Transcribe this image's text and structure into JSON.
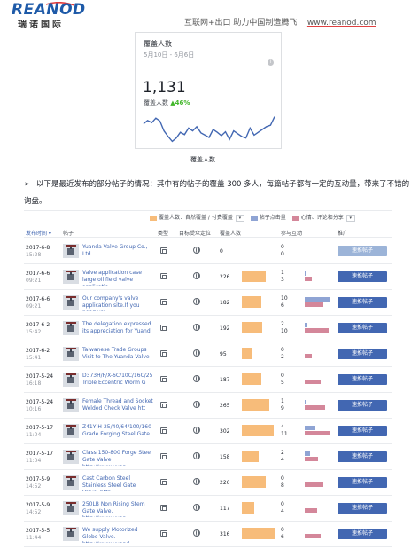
{
  "header": {
    "logo_text": "REANOD",
    "logo_cn": "瑞诺国际",
    "slogan": "互联网+出口  助力中国制造腾飞",
    "url": "www.reanod.com"
  },
  "reach_card": {
    "title": "覆盖人数",
    "date_range": "5月10日 - 6月6日",
    "info_icon": "i",
    "value": "1,131",
    "sub_label": "覆盖人数",
    "change": "▲46%",
    "caption": "覆盖人数",
    "sparkline": [
      0.3,
      0.18,
      0.26,
      0.1,
      0.2,
      0.55,
      0.75,
      0.92,
      0.8,
      0.6,
      0.68,
      0.45,
      0.55,
      0.4,
      0.62,
      0.7,
      0.78,
      0.5,
      0.6,
      0.72,
      0.58,
      0.85,
      0.55,
      0.65,
      0.75,
      0.8,
      0.45,
      0.7,
      0.6,
      0.5,
      0.4,
      0.35,
      0.05
    ]
  },
  "paragraph": {
    "arrow": "➢",
    "text": "以下是最近发布的部分帖子的情况：其中有的帖子的覆盖 300 多人，每篇帖子都有一定的互动量，带来了不错的询盘。"
  },
  "legend": {
    "reach": "覆盖人数：自然覆盖 / 付费覆盖",
    "clicks": "帖子点击量",
    "reactions": "心情、评论和分享",
    "dropdown": "▾"
  },
  "columns": {
    "date": "发布时间 ▾",
    "post": "帖子",
    "type": "类型",
    "targeting": "目标受众定位",
    "reach": "覆盖人数",
    "engagement": "参与互动",
    "promote": "推广"
  },
  "colors": {
    "reach_bar": "#f7bc7a",
    "clicks_bar": "#8fa4d4",
    "reactions_bar": "#d4879a",
    "button": "#4267b2"
  },
  "rows": [
    {
      "date": "2017-6-8",
      "time": "15:28",
      "text": "Yuanda Valve Group Co., Ltd.",
      "reach": "0",
      "clicks": "0",
      "reactions": "0",
      "clicks_frac": 0,
      "reactions_frac": 0,
      "boost": "速推帖子",
      "disabled": true
    },
    {
      "date": "2017-6-6",
      "time": "09:21",
      "text": "Valve application case large oil field valve applicatio",
      "reach": "226",
      "clicks": "1",
      "reactions": "3",
      "clicks_frac": 0.05,
      "reactions_frac": 0.25,
      "boost": "速推帖子",
      "disabled": false
    },
    {
      "date": "2017-6-6",
      "time": "09:21",
      "text": "Our company's valve application site.If you need val",
      "reach": "182",
      "clicks": "10",
      "reactions": "6",
      "clicks_frac": 0.95,
      "reactions_frac": 0.7,
      "boost": "速推帖子",
      "disabled": false
    },
    {
      "date": "2017-6-2",
      "time": "15:42",
      "text": "The delegation expressed its appreciation for Yuand",
      "reach": "192",
      "clicks": "2",
      "reactions": "10",
      "clicks_frac": 0.1,
      "reactions_frac": 0.9,
      "boost": "速推帖子",
      "disabled": false
    },
    {
      "date": "2017-6-2",
      "time": "15:41",
      "text": "Taiwanese Trade Groups Visit to The Yuanda Valve",
      "reach": "95",
      "clicks": "0",
      "reactions": "2",
      "clicks_frac": 0,
      "reactions_frac": 0.25,
      "boost": "速推帖子",
      "disabled": false
    },
    {
      "date": "2017-5-24",
      "time": "16:18",
      "text": "D373H/F/X-6C/10C/16C/25 Triple Eccentric Worm G",
      "reach": "187",
      "clicks": "0",
      "reactions": "5",
      "clicks_frac": 0,
      "reactions_frac": 0.6,
      "boost": "速推帖子",
      "disabled": false
    },
    {
      "date": "2017-5-24",
      "time": "10:16",
      "text": "Female Thread and Socket Welded Check Valve htt",
      "reach": "265",
      "clicks": "1",
      "reactions": "9",
      "clicks_frac": 0.05,
      "reactions_frac": 0.75,
      "boost": "速推帖子",
      "disabled": false
    },
    {
      "date": "2017-5-17",
      "time": "11:04",
      "text": "Z41Y H-25/40/64/100/160 Grade Forging Steel Gate",
      "reach": "302",
      "clicks": "4",
      "reactions": "11",
      "clicks_frac": 0.4,
      "reactions_frac": 0.95,
      "boost": "速推帖子",
      "disabled": false
    },
    {
      "date": "2017-5-17",
      "time": "11:04",
      "text": "Class 150-800 Forge Steel Gate Valve http://www.yuan",
      "reach": "158",
      "clicks": "2",
      "reactions": "4",
      "clicks_frac": 0.2,
      "reactions_frac": 0.5,
      "boost": "速推帖子",
      "disabled": false
    },
    {
      "date": "2017-5-9",
      "time": "14:52",
      "text": "Cast Carbon Steel Stainless Steel Gate Valve. http",
      "reach": "226",
      "clicks": "0",
      "reactions": "8",
      "clicks_frac": 0,
      "reactions_frac": 0.7,
      "boost": "速推帖子",
      "disabled": false
    },
    {
      "date": "2017-5-9",
      "time": "14:52",
      "text": "250LB Non Rising Stem Gate Valve. http://www.yuan",
      "reach": "117",
      "clicks": "0",
      "reactions": "4",
      "clicks_frac": 0,
      "reactions_frac": 0.45,
      "boost": "速推帖子",
      "disabled": false
    },
    {
      "date": "2017-5-5",
      "time": "11:44",
      "text": "We supply Motorized Globe Valve. http://www.yuand",
      "reach": "316",
      "clicks": "0",
      "reactions": "6",
      "clicks_frac": 0,
      "reactions_frac": 0.6,
      "boost": "速推帖子",
      "disabled": false
    }
  ]
}
